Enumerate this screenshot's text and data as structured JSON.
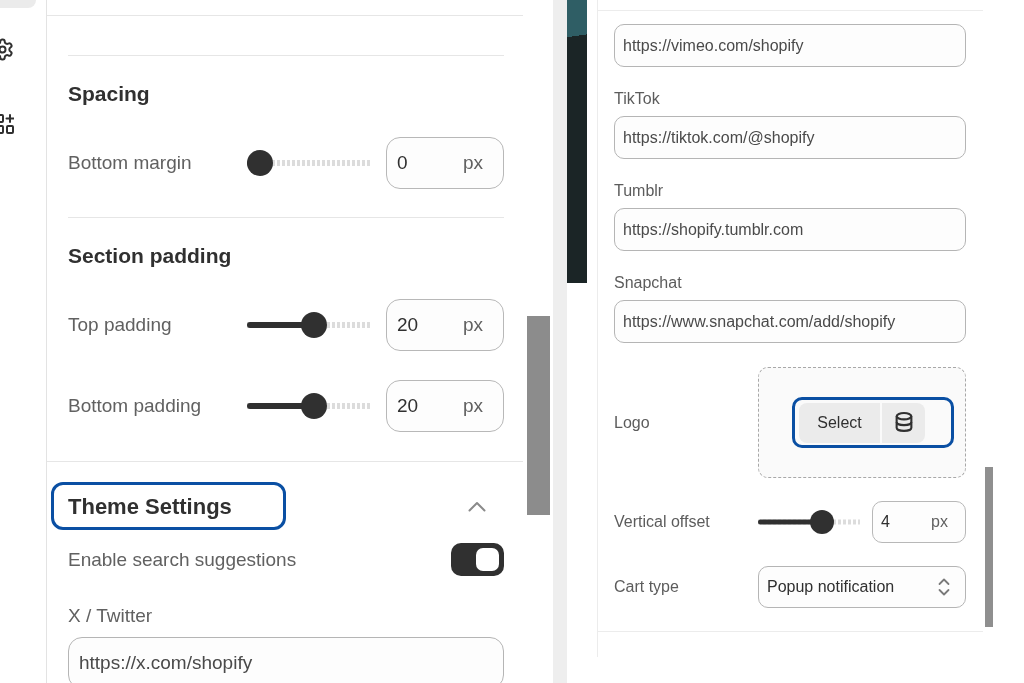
{
  "settings_panel": {
    "sections": [
      {
        "title": "Spacing",
        "controls": [
          {
            "kind": "range",
            "label": "Bottom margin",
            "level": 0,
            "value": "0",
            "unit": "px"
          }
        ]
      },
      {
        "title": "Section padding",
        "controls": [
          {
            "kind": "range",
            "label": "Top padding",
            "level": 0.55,
            "value": "20",
            "unit": "px"
          },
          {
            "kind": "range",
            "label": "Bottom padding",
            "level": 0.55,
            "value": "20",
            "unit": "px"
          }
        ]
      }
    ],
    "theme_settings": {
      "title": "Theme Settings",
      "focused": true,
      "expanded": true,
      "controls": [
        {
          "kind": "toggle",
          "label": "Enable search suggestions",
          "on": true
        },
        {
          "kind": "text",
          "label": "X / Twitter",
          "value": "https://x.com/shopify"
        }
      ]
    }
  },
  "theme_settings_continued": {
    "controls": [
      {
        "kind": "text",
        "value": "https://vimeo.com/shopify"
      },
      {
        "kind": "text",
        "label": "TikTok",
        "value": "https://tiktok.com/@shopify"
      },
      {
        "kind": "text",
        "label": "Tumblr",
        "value": "https://shopify.tumblr.com"
      },
      {
        "kind": "text",
        "label": "Snapchat",
        "value": "https://www.snapchat.com/add/shopify"
      },
      {
        "kind": "image_picker",
        "label": "Logo",
        "button": "Select",
        "focused": true
      },
      {
        "kind": "range",
        "label": "Vertical offset",
        "level": 0.67,
        "value": "4",
        "unit": "px"
      },
      {
        "kind": "select",
        "label": "Cart type",
        "value": "Popup notification"
      }
    ]
  }
}
